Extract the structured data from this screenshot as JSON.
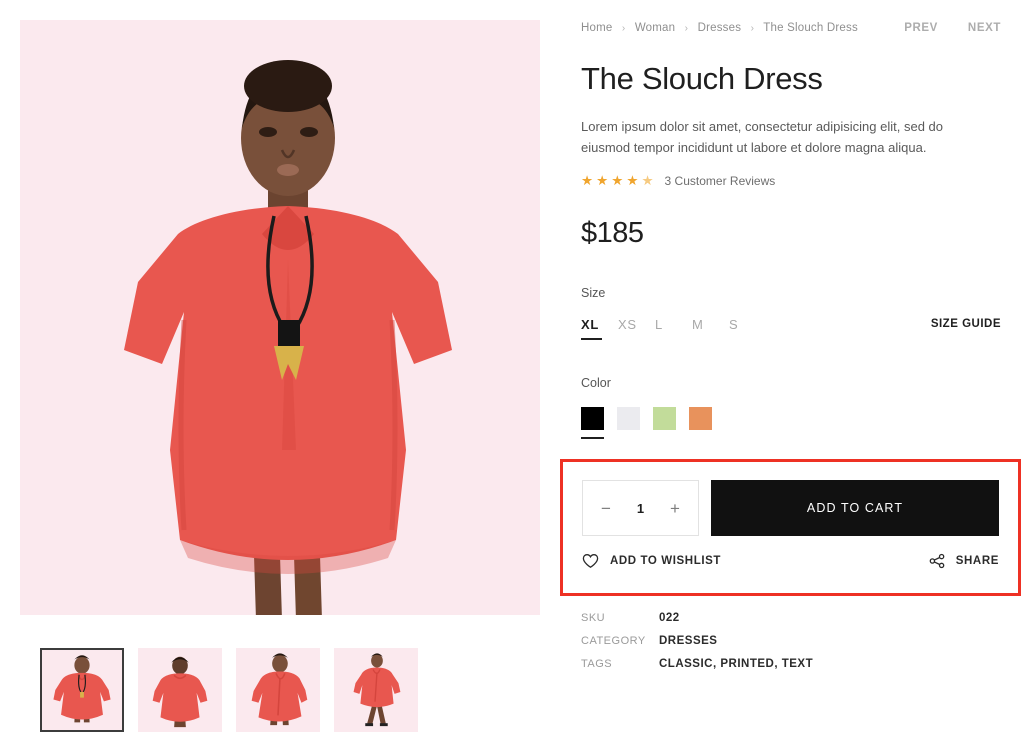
{
  "breadcrumb": {
    "items": [
      "Home",
      "Woman",
      "Dresses",
      "The Slouch Dress"
    ],
    "separator": "›"
  },
  "nav": {
    "prev": "PREV",
    "next": "NEXT"
  },
  "product": {
    "title": "The Slouch Dress",
    "description": "Lorem ipsum dolor sit amet, consectetur adipisicing elit, sed do eiusmod tempor incididunt ut labore et dolore magna aliqua.",
    "price": "$185",
    "rating_value": 4.5,
    "stars": [
      "★",
      "★",
      "★",
      "★",
      "★"
    ],
    "reviews_label": "3 Customer Reviews"
  },
  "size": {
    "label": "Size",
    "options": [
      "XL",
      "XS",
      "L",
      "M",
      "S"
    ],
    "selected": "XL",
    "guide_label": "SIZE GUIDE"
  },
  "color": {
    "label": "Color",
    "options": [
      {
        "name": "black",
        "hex": "#000000"
      },
      {
        "name": "white",
        "hex": "#ebebef"
      },
      {
        "name": "green",
        "hex": "#c2dc9a"
      },
      {
        "name": "orange",
        "hex": "#e8925c"
      }
    ],
    "selected": "black"
  },
  "cart": {
    "qty_minus": "−",
    "qty_value": "1",
    "qty_plus": "+",
    "add_to_cart_label": "ADD TO CART",
    "wishlist_label": "ADD TO WISHLIST",
    "share_label": "SHARE",
    "highlight_color": "#ee3124"
  },
  "meta": {
    "rows": [
      {
        "key": "SKU",
        "value": "022"
      },
      {
        "key": "CATEGORY",
        "value": "DRESSES"
      },
      {
        "key": "TAGS",
        "value": "CLASSIC, PRINTED, TEXT"
      }
    ]
  },
  "gallery": {
    "background": "#fbe9ee",
    "dress_color": "#e8574f",
    "thumbnails": [
      {
        "view": "front-with-necklace",
        "selected": true
      },
      {
        "view": "back",
        "selected": false
      },
      {
        "view": "three-quarter",
        "selected": false
      },
      {
        "view": "full-body-walking",
        "selected": false
      }
    ]
  }
}
